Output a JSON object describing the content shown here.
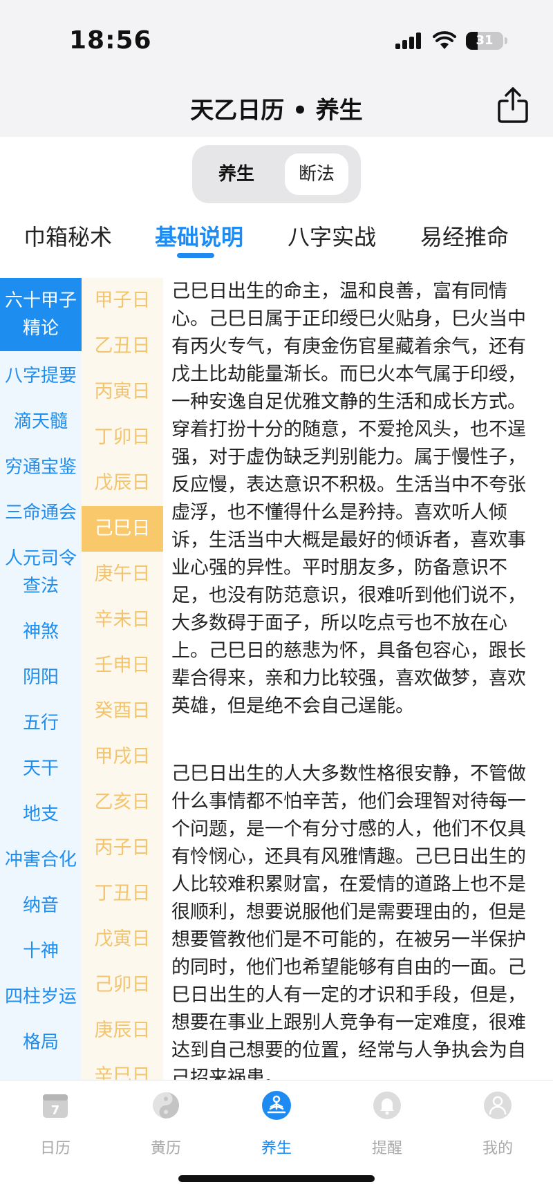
{
  "status_bar": {
    "time": "18:56",
    "battery": "31",
    "battery_fraction": 0.31
  },
  "nav": {
    "title": "天乙日历 • 养生",
    "share_icon": "share-icon"
  },
  "segment": {
    "options": [
      "养生",
      "断法"
    ],
    "selected": "养生"
  },
  "tabs": {
    "items": [
      "巾箱秘术",
      "基础说明",
      "八字实战",
      "易经推命"
    ],
    "active": "基础说明"
  },
  "left_menu": {
    "items": [
      "六十甲子\n精论",
      "八字提要",
      "滴天髓",
      "穷通宝鉴",
      "三命通会",
      "人元司令\n查法",
      "神煞",
      "阴阳",
      "五行",
      "天干",
      "地支",
      "冲害合化",
      "纳音",
      "十神",
      "四柱岁运",
      "格局"
    ],
    "active": "六十甲子\n精论"
  },
  "day_list": {
    "items": [
      "甲子日",
      "乙丑日",
      "丙寅日",
      "丁卯日",
      "戊辰日",
      "己巳日",
      "庚午日",
      "辛未日",
      "壬申日",
      "癸酉日",
      "甲戌日",
      "乙亥日",
      "丙子日",
      "丁丑日",
      "戊寅日",
      "己卯日",
      "庚辰日",
      "辛巳日"
    ],
    "active": "己巳日"
  },
  "content": {
    "paragraphs": [
      "己巳日出生的命主，温和良善，富有同情心。己巳日属于正印绶巳火贴身，巳火当中有丙火专气，有庚金伤官星藏着余气，还有戊土比劫能量渐长。而巳火本气属于印绶，一种安逸自足优雅文静的生活和成长方式。穿着打扮十分的随意，不爱抢风头，也不逞强，对于虚伪缺乏判别能力。属于慢性子，反应慢，表达意识不积极。生活当中不夸张虚浮，也不懂得什么是矜持。喜欢听人倾诉，生活当中大概是最好的倾诉者，喜欢事业心强的异性。平时朋友多，防备意识不足，也没有防范意识，很难听到他们说不，大多数碍于面子，所以吃点亏也不放在心上。己巳日的慈悲为怀，具备包容心，跟长辈合得来，亲和力比较强，喜欢做梦，喜欢英雄，但是绝不会自己逞能。",
      "己巳日出生的人大多数性格很安静，不管做什么事情都不怕辛苦，他们会理智对待每一个问题，是一个有分寸感的人，他们不仅具有怜悯心，还具有风雅情趣。己巳日出生的人比较难积累财富，在爱情的道路上也不是很顺利，想要说服他们是需要理由的，但是想要管教他们是不可能的，在被另一半保护的同时，他们也希望能够有自由的一面。己巳日出生的人有一定的才识和手段，但是，想要在事业上跟别人竞争有一定难度，很难达到自己想要的位置，经常与人争执会为自己招来祸患。"
    ]
  },
  "tabbar": {
    "items": [
      {
        "label": "日历",
        "icon": "calendar-icon"
      },
      {
        "label": "黄历",
        "icon": "yin-yang-icon"
      },
      {
        "label": "养生",
        "icon": "meditation-icon"
      },
      {
        "label": "提醒",
        "icon": "bell-icon"
      },
      {
        "label": "我的",
        "icon": "user-icon"
      }
    ],
    "active": "养生"
  },
  "colors": {
    "accent_blue": "#1d8bf1",
    "day_gold": "#f2c46d",
    "day_active_bg": "#f8c86a",
    "left_bg": "#eef6fe"
  }
}
